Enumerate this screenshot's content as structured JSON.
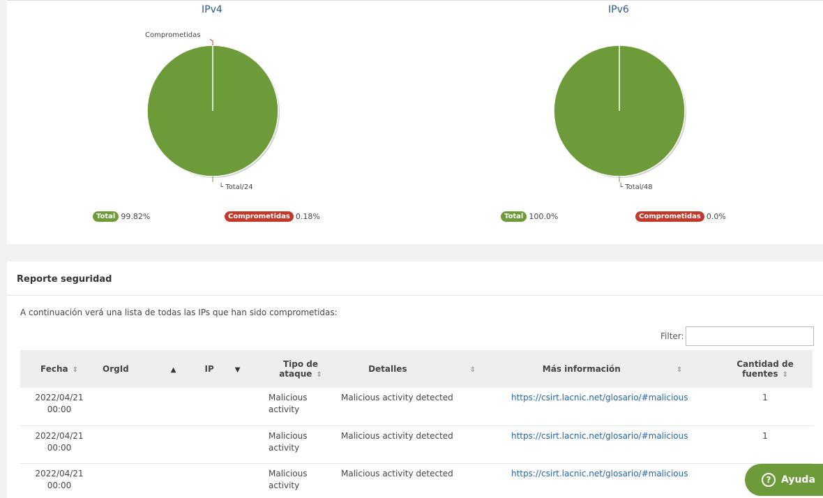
{
  "charts": {
    "ipv4": {
      "title": "IPv4",
      "label_top": "Comprometidas",
      "label_bottom": "Total/24",
      "legend": [
        {
          "badge": "Total",
          "value": "99.82%",
          "color": "#6e9b3a"
        },
        {
          "badge": "Comprometidas",
          "value": "0.18%",
          "color": "#c0392b"
        }
      ],
      "share_total": 0.9982,
      "share_compromised": 0.0018
    },
    "ipv6": {
      "title": "IPv6",
      "label_bottom": "Total/48",
      "legend": [
        {
          "badge": "Total",
          "value": "100.0%",
          "color": "#6e9b3a"
        },
        {
          "badge": "Comprometidas",
          "value": "0.0%",
          "color": "#c0392b"
        }
      ],
      "share_total": 1.0,
      "share_compromised": 0.0
    }
  },
  "report": {
    "title": "Reporte seguridad",
    "intro": "A continuación verá una lista de todas las IPs que han sido comprometidas:",
    "filter_label": "Filter:",
    "filter_value": "",
    "columns": [
      "Fecha",
      "OrgId",
      "IP",
      "Tipo de ataque",
      "Detalles",
      "Más información",
      "Cantidad de fuentes"
    ],
    "rows": [
      {
        "fecha": "2022/04/21 00:00",
        "orgid": "",
        "ip": "",
        "tipo": "Malicious activity",
        "detalles": "Malicious activity detected",
        "info": "https://csirt.lacnic.net/glosario/#malicious",
        "fuentes": "1"
      },
      {
        "fecha": "2022/04/21 00:00",
        "orgid": "",
        "ip": "",
        "tipo": "Malicious activity",
        "detalles": "Malicious activity detected",
        "info": "https://csirt.lacnic.net/glosario/#malicious",
        "fuentes": "1"
      },
      {
        "fecha": "2022/04/21 00:00",
        "orgid": "",
        "ip": "",
        "tipo": "Malicious activity",
        "detalles": "Malicious activity detected",
        "info": "https://csirt.lacnic.net/glosario/#malicious",
        "fuentes": ""
      }
    ]
  },
  "help_button": {
    "label": "Ayuda",
    "icon": "question-circle-icon"
  },
  "colors": {
    "accent_green": "#6e9b3a",
    "danger_red": "#c0392b",
    "link": "#2466a8"
  }
}
